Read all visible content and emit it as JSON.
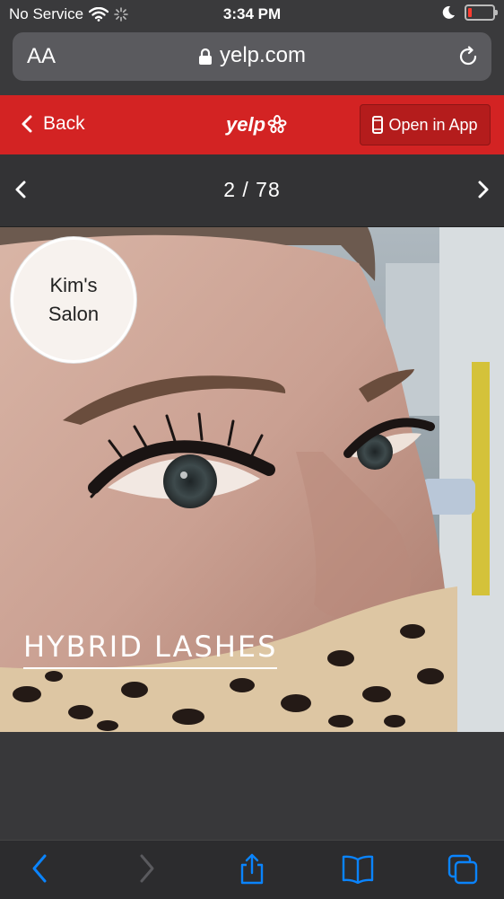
{
  "status": {
    "carrier": "No Service",
    "time": "3:34 PM"
  },
  "browser": {
    "text_size_label": "AA",
    "url": "yelp.com"
  },
  "header": {
    "back_label": "Back",
    "logo_text": "yelp",
    "open_app_label": "Open in App"
  },
  "photo_nav": {
    "counter": "2 / 78"
  },
  "photo": {
    "badge_line1": "Kim's",
    "badge_line2": "Salon",
    "caption": "HYBRID LASHES"
  },
  "colors": {
    "yelp_red": "#d32323",
    "ios_blue": "#0a84ff"
  },
  "toolbar": {
    "icons": [
      "back-icon",
      "forward-icon",
      "share-icon",
      "bookmarks-icon",
      "tabs-icon"
    ]
  }
}
